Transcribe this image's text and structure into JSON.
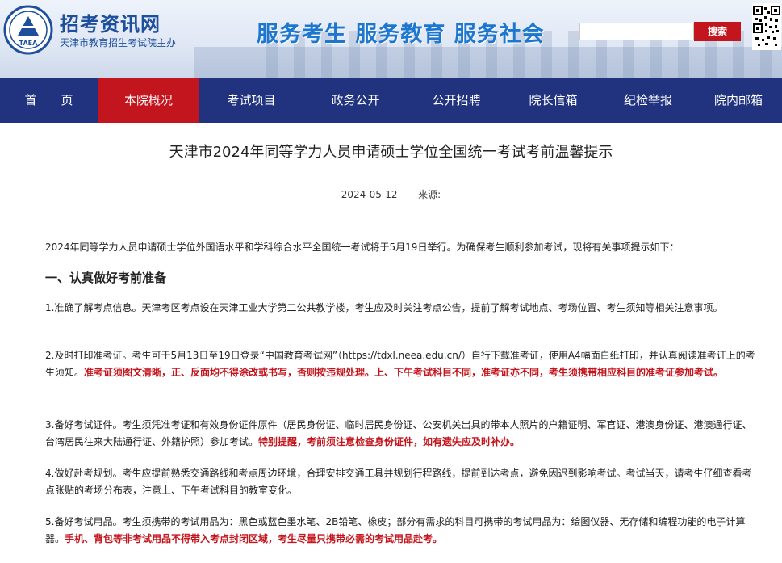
{
  "header": {
    "site_name": "招考资讯网",
    "site_subtitle": "天津市教育招生考试院主办",
    "logo_text": "TAEA",
    "slogan": "服务考生 服务教育 服务社会",
    "search": {
      "placeholder": "",
      "button_label": "搜索"
    }
  },
  "nav": {
    "items": [
      {
        "label": "首　　页"
      },
      {
        "label": "本院概况"
      },
      {
        "label": "考试项目"
      },
      {
        "label": "政务公开"
      },
      {
        "label": "公开招聘"
      },
      {
        "label": "院长信箱"
      },
      {
        "label": "纪检举报"
      },
      {
        "label": "院内邮箱"
      }
    ],
    "active_index": 1
  },
  "article": {
    "title": "天津市2024年同等学力人员申请硕士学位全国统一考试考前温馨提示",
    "date": "2024-05-12",
    "source_label": "来源:",
    "intro": "2024年同等学力人员申请硕士学位外国语水平和学科综合水平全国统一考试将于5月19日举行。为确保考生顺利参加考试，现将有关事项提示如下：",
    "section1_heading": "一、认真做好考前准备",
    "item1": "1.准确了解考点信息。天津考区考点设在天津工业大学第二公共教学楼，考生应及时关注考点公告，提前了解考试地点、考场位置、考生须知等相关注意事项。",
    "item2_normal": "2.及时打印准考证。考生可于5月13日至19日登录“中国教育考试网”（https://tdxl.neea.edu.cn/）自行下载准考证，使用A4幅面白纸打印，并认真阅读准考证上的考生须知。",
    "item2_red": "准考证须图文清晰，正、反面均不得涂改或书写，否则按违规处理。上、下午考试科目不同，准考证亦不同，考生须携带相应科目的准考证参加考试。",
    "item3_normal": "3.备好考试证件。考生须凭准考证和有效身份证件原件（居民身份证、临时居民身份证、公安机关出具的带本人照片的户籍证明、军官证、港澳身份证、港澳通行证、台湾居民往来大陆通行证、外籍护照）参加考试。",
    "item3_red": "特别提醒，考前须注意检查身份证件，如有遗失应及时补办。",
    "item4": "4.做好赴考规划。考生应提前熟悉交通路线和考点周边环境，合理安排交通工具并规划行程路线，提前到达考点，避免因迟到影响考试。考试当天，请考生仔细查看考点张贴的考场分布表，注意上、下午考试科目的教室变化。",
    "item5_normal": "5.备好考试用品。考生须携带的考试用品为：黑色或蓝色墨水笔、2B铅笔、橡皮；部分有需求的科目可携带的考试用品为：绘图仪器、无存储和编程功能的电子计算器。",
    "item5_red": "手机、背包等非考试用品不得带入考点封闭区域，考生尽量只携带必需的考试用品赴考。"
  },
  "colors": {
    "nav_bg": "#21337f",
    "nav_active": "#c3151d",
    "brand_blue": "#1d4f9c",
    "alert_red": "#c3151d"
  }
}
